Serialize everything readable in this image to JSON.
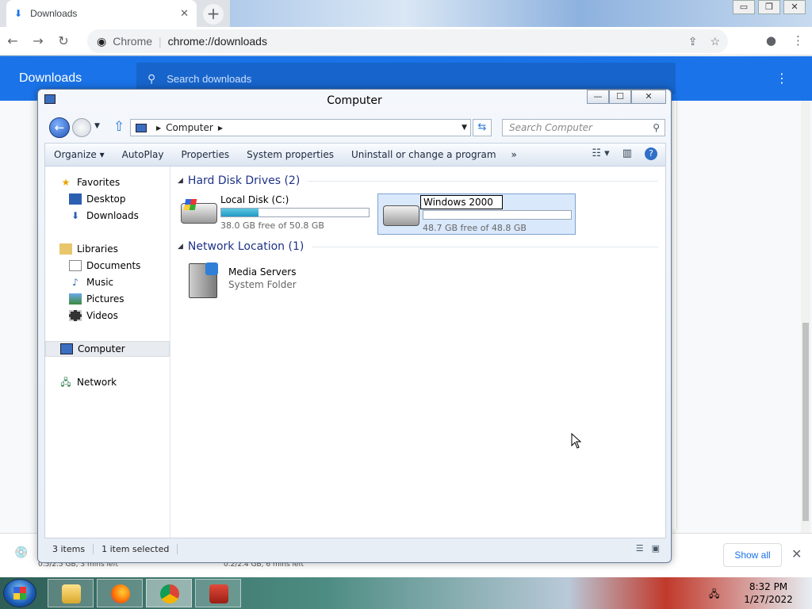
{
  "browser": {
    "tab_title": "Downloads",
    "tab_close": "✕",
    "new_tab": "+",
    "window_controls": [
      "▭",
      "❐",
      "✕"
    ],
    "site_chip": "Chrome",
    "url": "chrome://downloads",
    "downloads_title": "Downloads",
    "search_placeholder": "Search downloads",
    "shelf": {
      "item1_sub": "0.5/2.5 GB, 3 mins left",
      "item2_sub": "0.2/2.4 GB, 6 mins left",
      "show_all": "Show all",
      "close": "✕"
    }
  },
  "explorer": {
    "title": "Computer",
    "controls": {
      "minimize": "—",
      "maximize": "☐",
      "close": "✕"
    },
    "address": {
      "segment": "Computer"
    },
    "search_placeholder": "Search Computer",
    "toolbar": {
      "organize": "Organize ▾",
      "autoplay": "AutoPlay",
      "properties": "Properties",
      "system_properties": "System properties",
      "uninstall": "Uninstall or change a program",
      "more": "»"
    },
    "nav": {
      "favorites": "Favorites",
      "desktop": "Desktop",
      "downloads": "Downloads",
      "libraries": "Libraries",
      "documents": "Documents",
      "music": "Music",
      "pictures": "Pictures",
      "videos": "Videos",
      "computer": "Computer",
      "network": "Network"
    },
    "groups": {
      "hard_disks": "Hard Disk Drives (2)",
      "network_location": "Network Location (1)"
    },
    "drives": [
      {
        "name": "Local Disk (C:)",
        "free": "38.0 GB free of 50.8 GB",
        "used_fraction": 0.25
      },
      {
        "name": "Windows 2000",
        "free": "48.7 GB free of 48.8 GB",
        "used_fraction": 0.002
      }
    ],
    "network_item": {
      "name": "Media Servers",
      "type": "System Folder"
    },
    "status": {
      "items": "3 items",
      "selected": "1 item selected"
    }
  },
  "taskbar": {
    "time": "8:32 PM",
    "date": "1/27/2022"
  }
}
